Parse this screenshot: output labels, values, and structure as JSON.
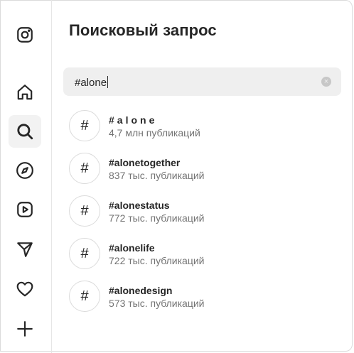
{
  "panel": {
    "title": "Поисковый запрос"
  },
  "search": {
    "query": "#alone",
    "clear_icon": "×"
  },
  "nav": {
    "items": [
      {
        "name": "instagram-logo-icon"
      },
      {
        "name": "home-icon"
      },
      {
        "name": "search-icon"
      },
      {
        "name": "explore-icon"
      },
      {
        "name": "reels-icon"
      },
      {
        "name": "messages-icon"
      },
      {
        "name": "notifications-icon"
      },
      {
        "name": "create-icon"
      }
    ]
  },
  "results": [
    {
      "symbol": "#",
      "tag": "#alone",
      "count": "4,7 млн публикаций"
    },
    {
      "symbol": "#",
      "tag": "#alonetogether",
      "count": "837 тыс. публикаций"
    },
    {
      "symbol": "#",
      "tag": "#alonestatus",
      "count": "772 тыс. публикаций"
    },
    {
      "symbol": "#",
      "tag": "#alonelife",
      "count": "722 тыс. публикаций"
    },
    {
      "symbol": "#",
      "tag": "#alonedesign",
      "count": "573 тыс. публикаций"
    }
  ],
  "colors": {
    "text": "#262626",
    "secondary": "#737373",
    "search_bg": "#efefef",
    "active_nav_bg": "#f2f2f2"
  }
}
